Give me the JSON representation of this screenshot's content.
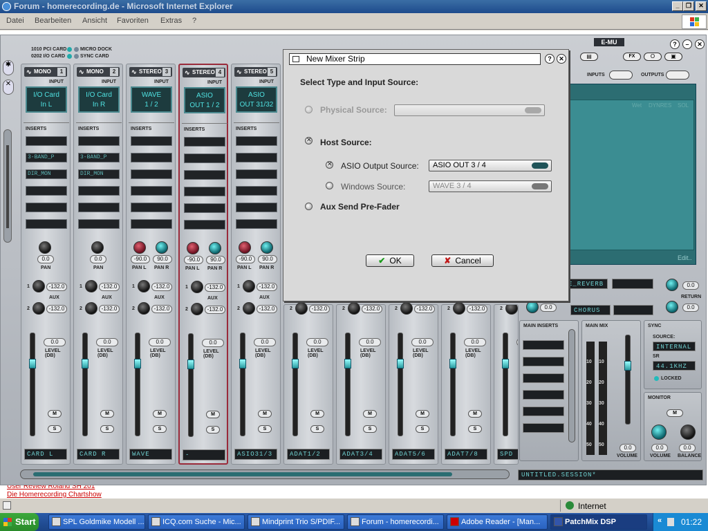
{
  "window": {
    "title": "Forum - homerecording.de - Microsoft Internet Explorer"
  },
  "menu": [
    "Datei",
    "Bearbeiten",
    "Ansicht",
    "Favoriten",
    "Extras",
    "?"
  ],
  "page_links": [
    "User Review Roland SH 201",
    "Die Homerecording Chartshow"
  ],
  "patchmix": {
    "cards": {
      "pci": "1010 PCI CARD",
      "io": "0202 I/O CARD",
      "dock": "MICRO DOCK",
      "sync": "SYNC CARD"
    },
    "brand": "E-MU",
    "labels": {
      "input": "INPUT",
      "inserts": "INSERTS",
      "pan": "PAN",
      "panl": "PAN L",
      "panr": "PAN R",
      "aux": "AUX",
      "level": "LEVEL (DB)",
      "mute": "M",
      "solo": "S",
      "inputs": "INPUTS",
      "outputs": "OUTPUTS",
      "return": "RETURN",
      "main_inserts": "MAIN INSERTS",
      "main_mix": "MAIN MIX",
      "sync": "SYNC",
      "source": "SOURCE:",
      "sr": "SR",
      "locked": "LOCKED",
      "monitor": "MONITOR",
      "volume": "VOLUME",
      "balance": "BALANCE",
      "edit": "Edit..",
      "wet": "Wet",
      "dynres": "DYNRES",
      "sol": "SOL"
    },
    "strips": [
      {
        "type": "MONO",
        "num": "1",
        "src1": "I/O Card",
        "src2": "In L",
        "inserts": [
          "",
          "3-BAND_P",
          "DIR_MON",
          "",
          "",
          ""
        ],
        "pan": [
          "0.0"
        ],
        "fader": "0.0",
        "aux": [
          "-132.0",
          "-132.0"
        ],
        "name": "CARD L"
      },
      {
        "type": "MONO",
        "num": "2",
        "src1": "I/O Card",
        "src2": "In R",
        "inserts": [
          "",
          "3-BAND_P",
          "DIR_MON",
          "",
          "",
          ""
        ],
        "pan": [
          "0.0"
        ],
        "fader": "0.0",
        "aux": [
          "-132.0",
          "-132.0"
        ],
        "name": "CARD R"
      },
      {
        "type": "STEREO",
        "num": "3",
        "src1": "WAVE",
        "src2": "1 / 2",
        "inserts": [
          "",
          "",
          "",
          "",
          "",
          ""
        ],
        "pan": [
          "-90.0",
          "90.0"
        ],
        "fader": "0.0",
        "aux": [
          "-132.0",
          "-132.0"
        ],
        "name": "WAVE"
      },
      {
        "type": "STEREO",
        "num": "4",
        "src1": "ASIO",
        "src2": "OUT 1 / 2",
        "inserts": [
          "",
          "",
          "",
          "",
          "",
          ""
        ],
        "pan": [
          "-90.0",
          "90.0"
        ],
        "fader": "0.0",
        "aux": [
          "-132.0",
          "-132.0"
        ],
        "name": "-"
      },
      {
        "type": "STEREO",
        "num": "5",
        "src1": "ASIO",
        "src2": "OUT 31/32",
        "inserts": [
          "",
          "",
          "",
          "",
          "",
          ""
        ],
        "pan": [
          "-90.0",
          "90.0"
        ],
        "fader": "0.0",
        "aux": [
          "-132.0",
          "-132.0"
        ],
        "name": "ASIO31/3"
      }
    ],
    "lower_strips": [
      {
        "aux": [
          "-132.0",
          "-132.0"
        ],
        "fader": "0.0",
        "name": "ADAT1/2"
      },
      {
        "aux": [
          "-132.0",
          "-132.0"
        ],
        "fader": "0.0",
        "name": "ADAT3/4"
      },
      {
        "aux": [
          "-132.0",
          "-132.0"
        ],
        "fader": "0.0",
        "name": "ADAT5/6"
      },
      {
        "aux": [
          "-132.0",
          "-132.0"
        ],
        "fader": "0.0",
        "name": "ADAT7/8"
      },
      {
        "aux": [
          "-132.0",
          "-132.0"
        ],
        "fader": "0.0",
        "name": "SPD"
      }
    ],
    "fx": {
      "reverb": "E_REVERB",
      "chorus": "CHORUS",
      "return_vals": [
        "0.0",
        "0.0"
      ],
      "aux2_val": "0.0"
    },
    "sync": {
      "source": "INTERNAL",
      "sr": "44.1KHZ"
    },
    "main_mix": {
      "scale": [
        "10",
        "20",
        "30",
        "40",
        "50"
      ],
      "volume": "0.0"
    },
    "monitor": {
      "volume": "0.0",
      "balance": "0.0"
    },
    "session": "UNTITLED.SESSION*"
  },
  "dialog": {
    "title": "New Mixer Strip",
    "heading": "Select Type and Input Source:",
    "physical": "Physical Source:",
    "host": "Host Source:",
    "asio": "ASIO Output Source:",
    "asio_value": "ASIO OUT 3 / 4",
    "windows": "Windows Source:",
    "windows_value": "WAVE 3 / 4",
    "aux": "Aux Send Pre-Fader",
    "ok": "OK",
    "cancel": "Cancel",
    "help": "?",
    "close": "✕"
  },
  "status": {
    "zone": "Internet"
  },
  "taskbar": {
    "start": "Start",
    "tasks": [
      "SPL Goldmike Modell ...",
      "ICQ.com Suche - Mic...",
      "Mindprint Trio S/PDIF...",
      "Forum - homerecordi...",
      "Adobe Reader - [Man...",
      "PatchMix DSP"
    ],
    "clock": "01:22"
  }
}
